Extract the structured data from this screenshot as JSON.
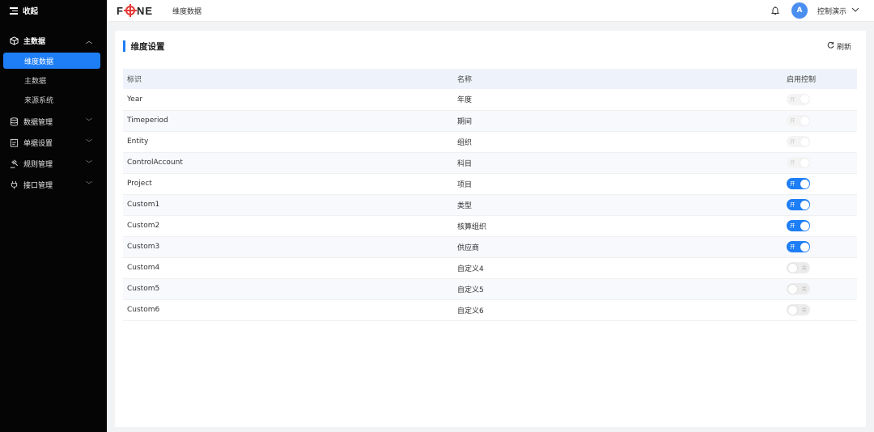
{
  "sidebar": {
    "collapse_label": "收起",
    "groups": [
      {
        "label": "主数据",
        "icon": "cube-icon",
        "expanded": true
      },
      {
        "label": "数据管理",
        "icon": "database-icon"
      },
      {
        "label": "单据设置",
        "icon": "document-icon"
      },
      {
        "label": "规则管理",
        "icon": "gavel-icon"
      },
      {
        "label": "接口管理",
        "icon": "plug-icon"
      }
    ],
    "sub_items": [
      {
        "label": "维度数据",
        "active": true
      },
      {
        "label": "主数据"
      },
      {
        "label": "来源系统"
      }
    ]
  },
  "header": {
    "logo": {
      "left": "F",
      "right": "NE"
    },
    "title": "维度数据",
    "avatar_letter": "A",
    "user_name": "控制演示"
  },
  "panel": {
    "title": "维度设置",
    "refresh_label": "刷新",
    "columns": [
      "标识",
      "名称",
      "启用控制"
    ],
    "rows": [
      {
        "id": "Year",
        "name": "年度",
        "toggle": "开",
        "state": "on-disabled"
      },
      {
        "id": "Timeperiod",
        "name": "期间",
        "toggle": "开",
        "state": "on-disabled"
      },
      {
        "id": "Entity",
        "name": "组织",
        "toggle": "开",
        "state": "on-disabled"
      },
      {
        "id": "ControlAccount",
        "name": "科目",
        "toggle": "开",
        "state": "on-disabled"
      },
      {
        "id": "Project",
        "name": "项目",
        "toggle": "开",
        "state": "on"
      },
      {
        "id": "Custom1",
        "name": "类型",
        "toggle": "开",
        "state": "on"
      },
      {
        "id": "Custom2",
        "name": "核算组织",
        "toggle": "开",
        "state": "on"
      },
      {
        "id": "Custom3",
        "name": "供应商",
        "toggle": "开",
        "state": "on"
      },
      {
        "id": "Custom4",
        "name": "自定义4",
        "toggle": "关",
        "state": "off"
      },
      {
        "id": "Custom5",
        "name": "自定义5",
        "toggle": "关",
        "state": "off"
      },
      {
        "id": "Custom6",
        "name": "自定义6",
        "toggle": "关",
        "state": "off"
      }
    ]
  },
  "colors": {
    "accent": "#1e7ef5",
    "sidebar_bg": "#050505",
    "table_header_bg": "#eef3fb"
  }
}
